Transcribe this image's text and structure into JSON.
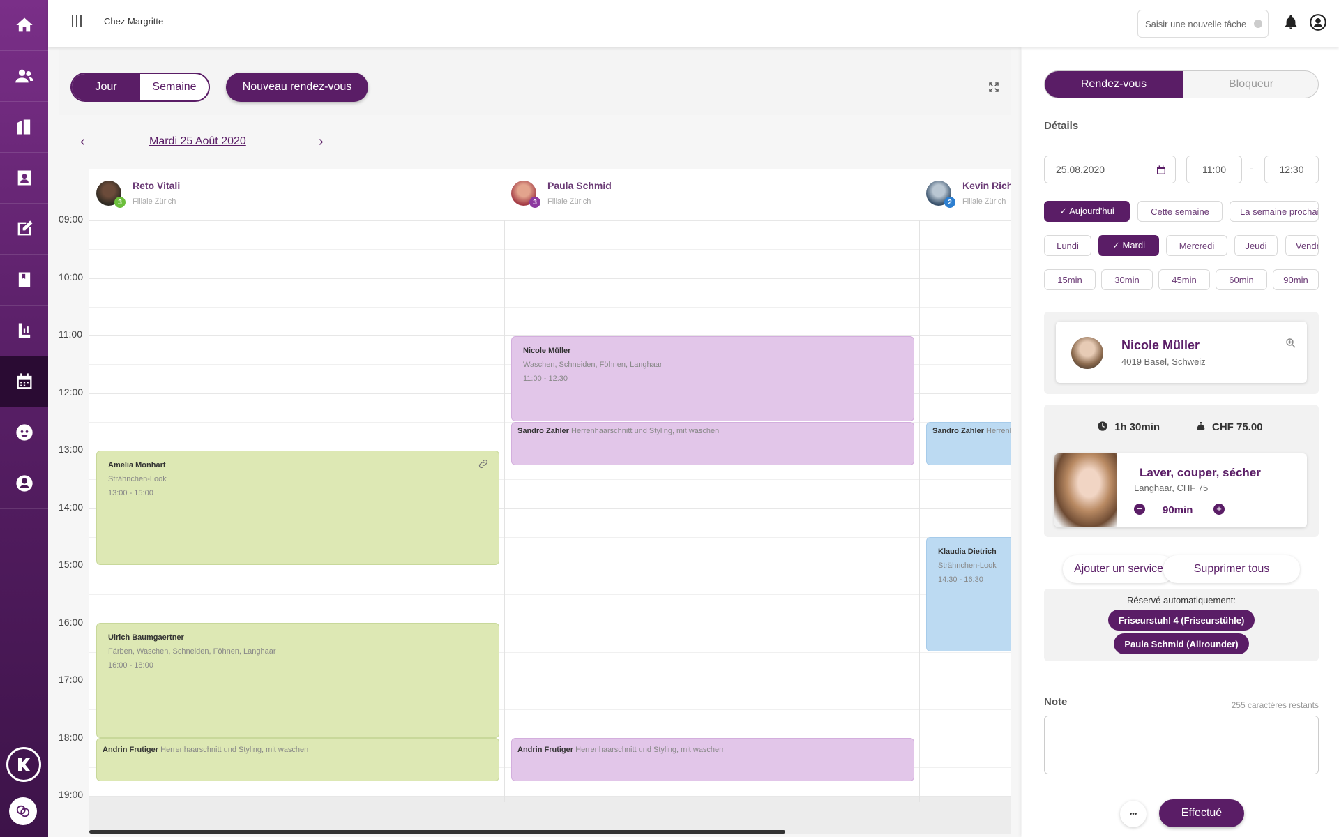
{
  "app": {
    "salon_name": "Chez Margritte"
  },
  "topbar": {
    "task_placeholder": "Saisir une nouvelle tâche"
  },
  "sidebar": {
    "items": [
      {
        "icon": "home-icon"
      },
      {
        "icon": "users-icon"
      },
      {
        "icon": "building-icon"
      },
      {
        "icon": "contacts-icon"
      },
      {
        "icon": "edit-icon"
      },
      {
        "icon": "book-icon"
      },
      {
        "icon": "chart-icon"
      },
      {
        "icon": "calendar-icon",
        "active": true
      },
      {
        "icon": "face-icon"
      },
      {
        "icon": "account-icon"
      }
    ]
  },
  "toolbar": {
    "view_day": "Jour",
    "view_week": "Semaine",
    "new_appointment": "Nouveau rendez-vous",
    "active_view": "Jour"
  },
  "calendar": {
    "date_label": "Mardi 25 Août 2020",
    "hours": [
      "09:00",
      "10:00",
      "11:00",
      "12:00",
      "13:00",
      "14:00",
      "15:00",
      "16:00",
      "17:00",
      "18:00",
      "19:00"
    ],
    "staff": [
      {
        "name": "Reto Vitali",
        "branch": "Filiale Zürich",
        "badge": "3",
        "badge_color": "#6cbf3c"
      },
      {
        "name": "Paula Schmid",
        "branch": "Filiale Zürich",
        "badge": "3",
        "badge_color": "#8d3aa0"
      },
      {
        "name": "Kevin Richards",
        "branch": "Filiale Zürich",
        "badge": "2",
        "badge_color": "#2d7fd0"
      }
    ],
    "events": [
      {
        "client": "Amelia Monhart",
        "service": "Strähnchen-Look",
        "time": "13:00 - 15:00"
      },
      {
        "client": "Ulrich Baumgaertner",
        "service": "Färben, Waschen, Schneiden, Föhnen, Langhaar",
        "time": "16:00 - 18:00"
      },
      {
        "client": "Andrin Frutiger",
        "service": "Herrenhaarschnitt und Styling, mit waschen"
      },
      {
        "client": "Nicole Müller",
        "service": "Waschen, Schneiden, Föhnen, Langhaar",
        "time": "11:00 - 12:30"
      },
      {
        "client": "Sandro Zahler",
        "service": "Herrenhaarschnitt und Styling, mit waschen"
      },
      {
        "client": "Andrin Frutiger",
        "service": "Herrenhaarschnitt und Styling, mit waschen"
      },
      {
        "client": "Sandro Zahler",
        "service": "Herrenhaarschnitt und Styling, mit waschen"
      },
      {
        "client": "Klaudia Dietrich",
        "service": "Strähnchen-Look",
        "time": "14:30 - 16:30"
      }
    ]
  },
  "panel": {
    "tab_appointment": "Rendez-vous",
    "tab_blocker": "Bloqueur",
    "details_label": "Détails",
    "date_value": "25.08.2020",
    "start_time": "11:00",
    "time_separator": "-",
    "end_time": "12:30",
    "quick_dates": [
      "✓ Aujourd'hui",
      "Cette semaine",
      "La semaine prochaine"
    ],
    "weekdays": [
      "Lundi",
      "✓ Mardi",
      "Mercredi",
      "Jeudi",
      "Vendredi"
    ],
    "durations": [
      "15min",
      "30min",
      "45min",
      "60min",
      "90min"
    ],
    "client": {
      "name": "Nicole Müller",
      "address": "4019 Basel, Schweiz"
    },
    "summary": {
      "duration": "1h 30min",
      "price": "CHF 75.00"
    },
    "service": {
      "name": "Laver, couper, sécher",
      "sub": "Langhaar, CHF 75",
      "duration": "90min"
    },
    "add_service": "Ajouter un service",
    "remove_all": "Supprimer tous",
    "auto_reserved_label": "Réservé automatiquement:",
    "resources": [
      "Friseurstuhl 4 (Friseurstühle)",
      "Paula Schmid (Allrounder)"
    ],
    "note_label": "Note",
    "note_remaining": "255 caractères restants",
    "more": "•••",
    "done": "Effectué"
  },
  "colors": {
    "brand": "#5a1d66",
    "green_event": "#dde8b4",
    "purple_event": "#e2c6e9",
    "blue_event": "#bcdaf2"
  }
}
